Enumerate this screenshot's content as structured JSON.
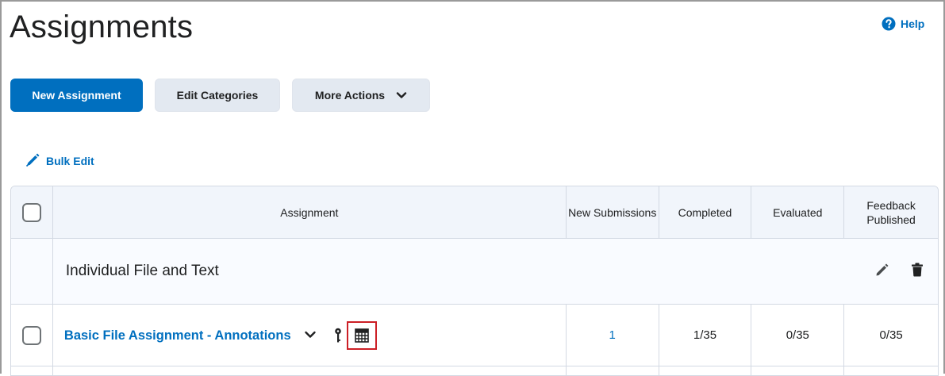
{
  "page": {
    "title": "Assignments",
    "help_label": "Help"
  },
  "toolbar": {
    "new_label": "New Assignment",
    "edit_categories_label": "Edit Categories",
    "more_actions_label": "More Actions"
  },
  "bulk_edit_label": "Bulk Edit",
  "table": {
    "columns": [
      "Assignment",
      "New Submissions",
      "Completed",
      "Evaluated",
      "Feedback Published"
    ],
    "groups": [
      {
        "title": "Individual File and Text",
        "rows": [
          {
            "name": "Basic File Assignment - Annotations",
            "new_submissions": "1",
            "completed": "1/35",
            "evaluated": "0/35",
            "feedback_published": "0/35"
          }
        ]
      }
    ]
  },
  "colors": {
    "accent": "#006fbf",
    "highlight": "#cc1f26",
    "secondary_button": "#e3e9f1"
  },
  "icons": [
    "help-icon",
    "chevron-down-icon",
    "pencil-icon",
    "trash-icon",
    "key-icon",
    "grid-icon"
  ]
}
